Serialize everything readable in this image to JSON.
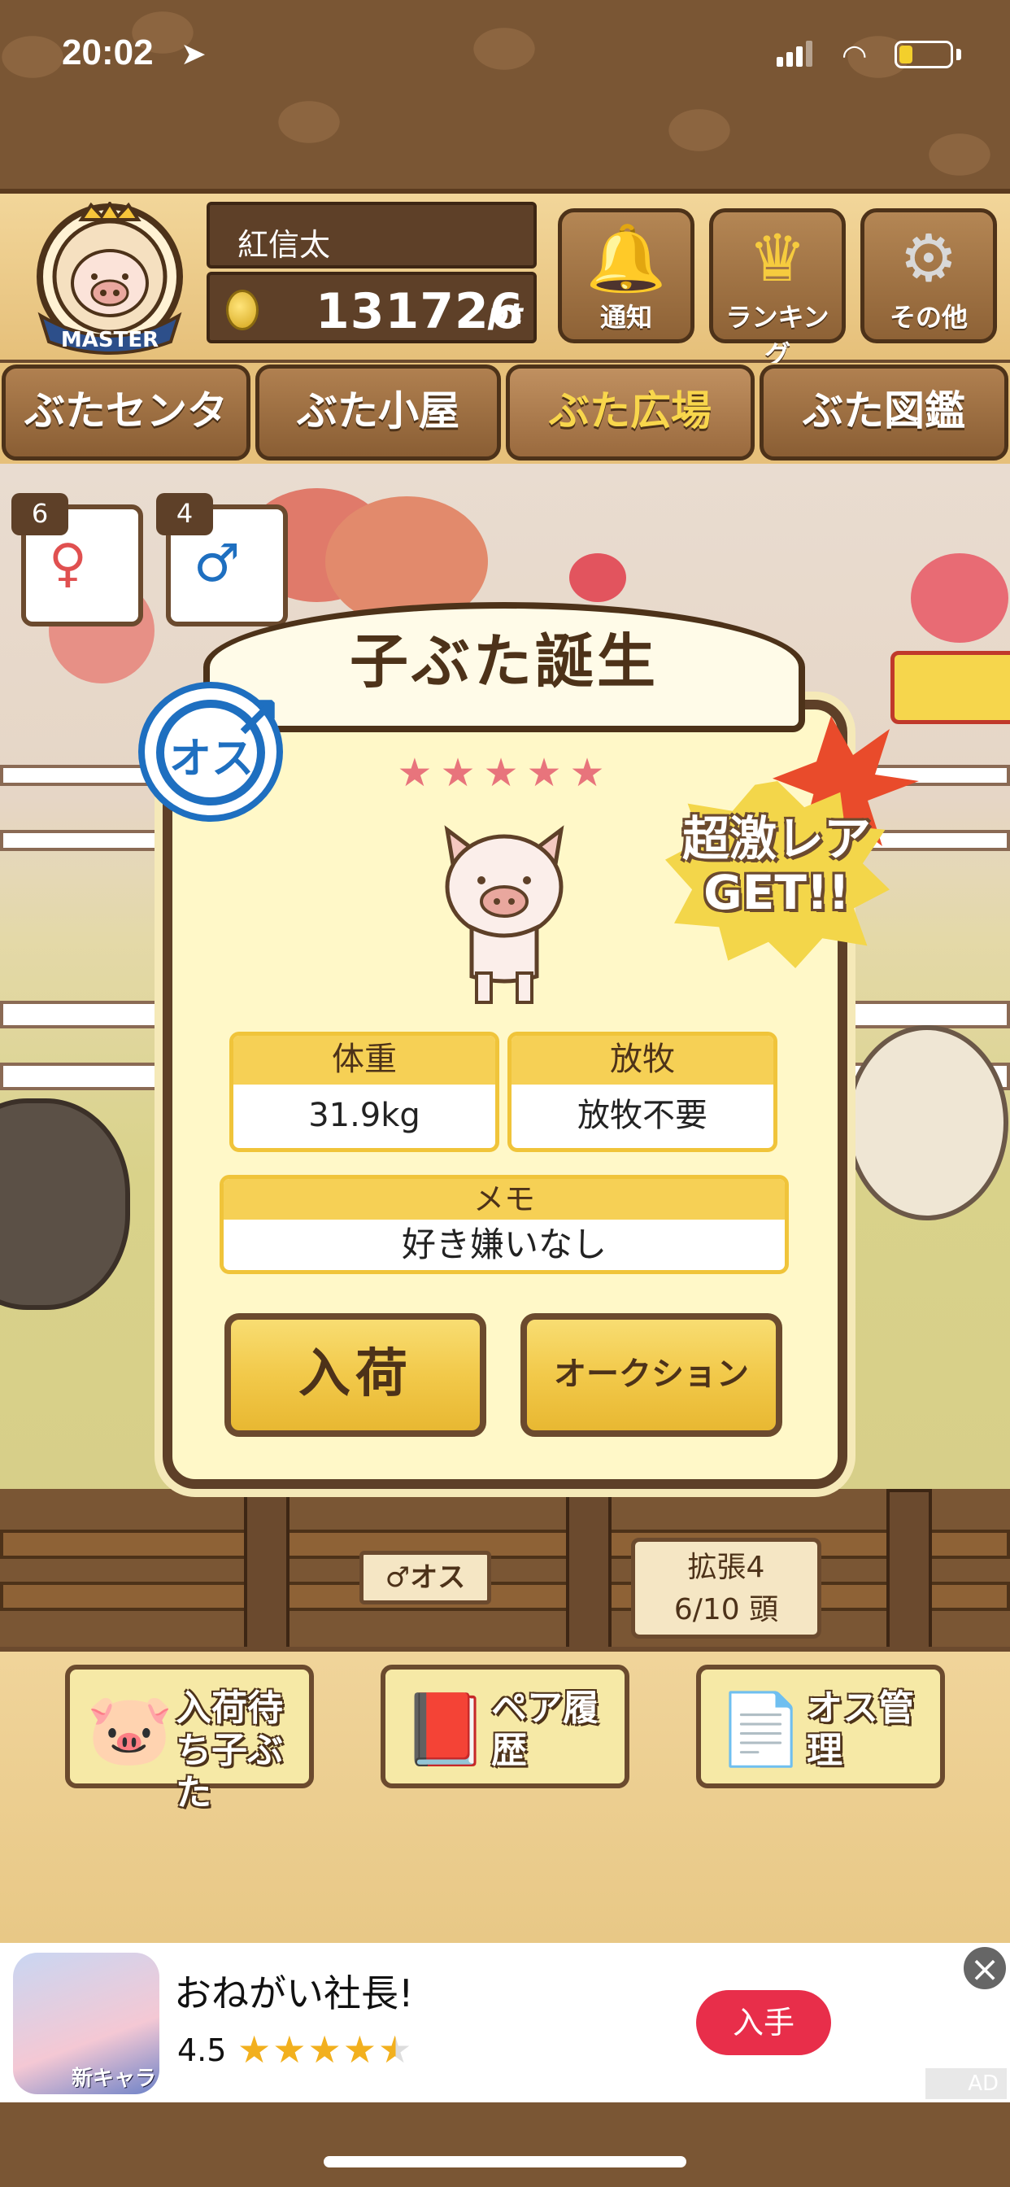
{
  "status_bar": {
    "time": "20:02",
    "battery_level": 0.2
  },
  "header": {
    "badge_label": "MASTER",
    "player_name": "紅信太",
    "points": "131726",
    "points_unit": "pt",
    "buttons": {
      "notify": "通知",
      "ranking": "ランキング",
      "other": "その他"
    }
  },
  "nav_tabs": [
    {
      "label": "ぶたセンター"
    },
    {
      "label": "ぶた小屋"
    },
    {
      "label": "ぶた広場"
    },
    {
      "label": "ぶた図鑑"
    }
  ],
  "tickets": {
    "female_count": "6",
    "male_count": "4"
  },
  "modal": {
    "title": "子ぶた誕生",
    "gender": "オス",
    "rarity_stars": 5,
    "rare_label": "超激レア GET!!",
    "weight_label": "体重",
    "weight_value": "31.9kg",
    "graze_label": "放牧",
    "graze_value": "放牧不要",
    "memo_label": "メモ",
    "memo_value": "好き嫌いなし",
    "accept_button": "入荷",
    "auction_button": "オークション"
  },
  "field_signs": {
    "male_sign": "♂オス",
    "expand_line1": "拡張4",
    "expand_line2": "6/10 頭"
  },
  "bottom_buttons": [
    {
      "label": "入荷待ち子ぶた"
    },
    {
      "label": "ペア履歴"
    },
    {
      "label": "オス管理"
    }
  ],
  "ad": {
    "icon_tag": "新キャラ",
    "title": "おねがい社長!",
    "rating": "4.5",
    "cta": "入手",
    "mark": "AD"
  },
  "colors": {
    "wood_dark": "#5e4028",
    "gold": "#f6d055",
    "male_blue": "#1e6fc0",
    "star_pink": "#e8747c",
    "ad_red": "#e82e4a"
  }
}
